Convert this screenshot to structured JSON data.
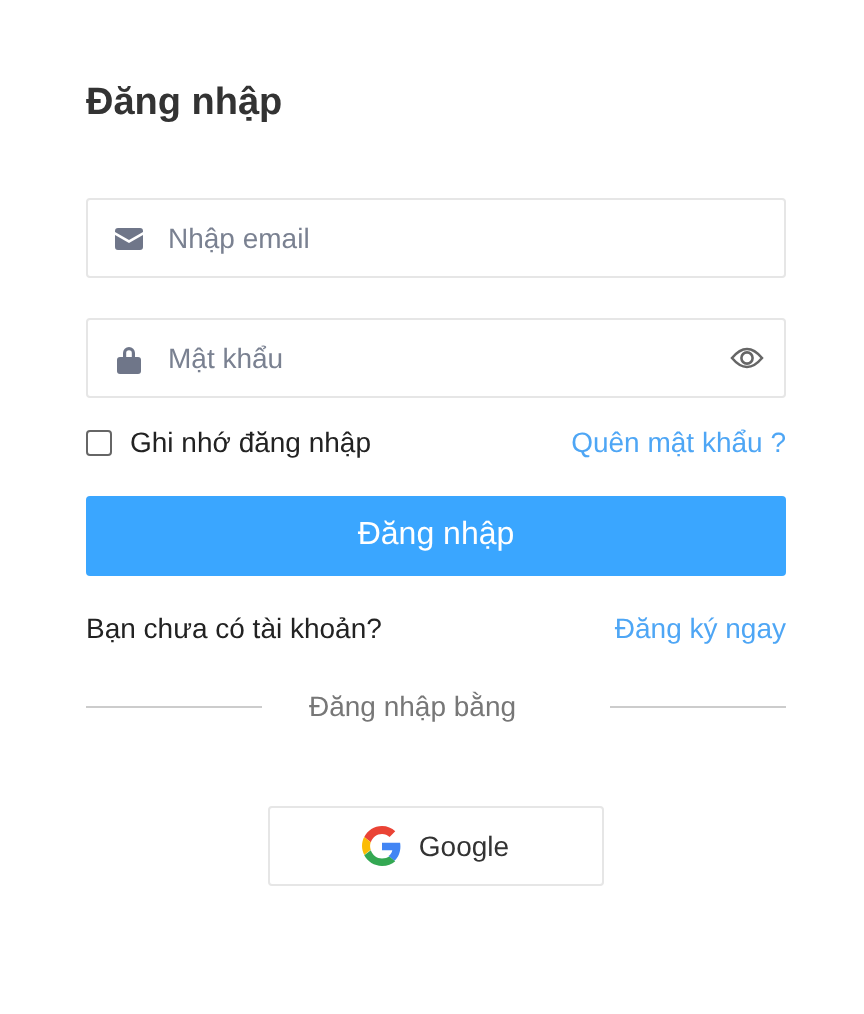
{
  "title": "Đăng nhập",
  "email_field": {
    "placeholder": "Nhập email"
  },
  "password_field": {
    "placeholder": "Mật khẩu"
  },
  "remember": {
    "label": "Ghi nhớ đăng nhập",
    "checked": false
  },
  "forgot_link": "Quên mật khẩu ?",
  "submit_button": "Đăng nhập",
  "signup_prompt": "Bạn chưa có tài khoản?",
  "signup_link": "Đăng ký ngay",
  "divider_text": "Đăng nhập bằng",
  "google_button": "Google"
}
